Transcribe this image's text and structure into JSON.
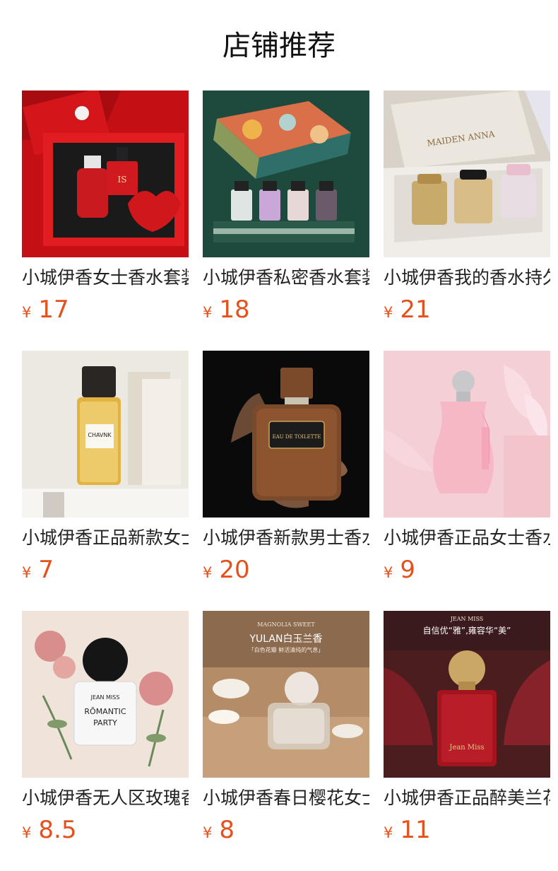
{
  "header": {
    "title": "店铺推荐"
  },
  "currency_symbol": "¥",
  "colors": {
    "price": "#e5511d",
    "title": "#111111",
    "name": "#222222"
  },
  "products": [
    {
      "name": "小城伊香女士香水套装",
      "price": "17",
      "image": "red-perfume-gift-box",
      "image_text": [
        "IS"
      ]
    },
    {
      "name": "小城伊香私密香水套装",
      "price": "18",
      "image": "floral-box-four-bottles",
      "image_text": []
    },
    {
      "name": "小城伊香我的香水持久",
      "price": "21",
      "image": "maiden-anna-gift-set",
      "image_text": [
        "MAIDEN ANNA"
      ]
    },
    {
      "name": "小城伊香正品新款女士",
      "price": "7",
      "image": "chavnk-yellow-bottle",
      "image_text": [
        "CHAVNK"
      ]
    },
    {
      "name": "小城伊香新款男士香水",
      "price": "20",
      "image": "wooden-bottle-in-hand",
      "image_text": [
        "EAU DE TOILETTE"
      ]
    },
    {
      "name": "小城伊香正品女士香水",
      "price": "9",
      "image": "pink-bottle-tassel",
      "image_text": []
    },
    {
      "name": "小城伊香无人区玫瑰香水",
      "price": "8.5",
      "image": "romantic-party-bottle",
      "image_text": [
        "JEAN MISS",
        "RŌMANTIC",
        "PARTY"
      ]
    },
    {
      "name": "小城伊香春日樱花女士",
      "price": "8",
      "image": "yulan-bottle-sand",
      "image_text": [
        "MAGNOLIA SWEET",
        "YULAN白玉兰香",
        "「白色花瓣 鲜活清纯的气息」"
      ]
    },
    {
      "name": "小城伊香正品醉美兰花",
      "price": "11",
      "image": "jean-miss-red-bottle",
      "image_text": [
        "JEAN MISS",
        "自信优“雅”,雍容华“美”",
        "Jean Miss"
      ]
    }
  ]
}
